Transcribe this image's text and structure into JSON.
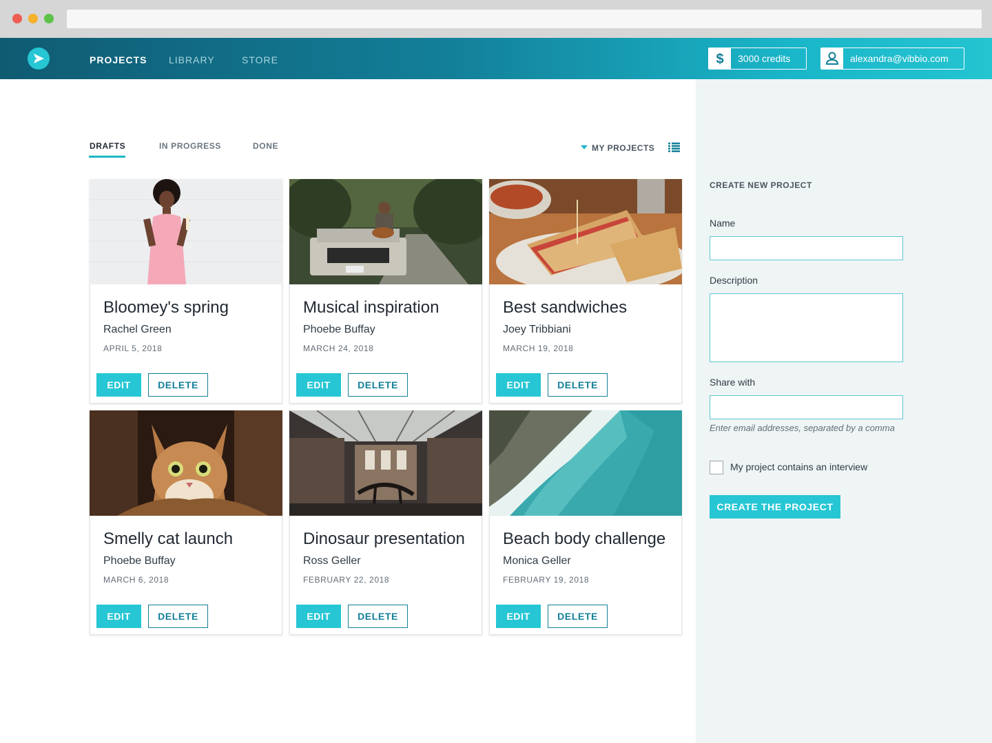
{
  "header": {
    "nav": [
      "PROJECTS",
      "LIBRARY",
      "STORE"
    ],
    "credits": "3000 credits",
    "user_email": "alexandra@vibbio.com"
  },
  "tabs": [
    "DRAFTS",
    "IN PROGRESS",
    "DONE"
  ],
  "filter_label": "MY PROJECTS",
  "cards": [
    {
      "title": "Bloomey's spring",
      "author": "Rachel Green",
      "date": "APRIL 5, 2018"
    },
    {
      "title": "Musical inspiration",
      "author": "Phoebe Buffay",
      "date": "MARCH 24, 2018"
    },
    {
      "title": "Best sandwiches",
      "author": "Joey Tribbiani",
      "date": "MARCH 19, 2018"
    },
    {
      "title": "Smelly cat launch",
      "author": "Phoebe Buffay",
      "date": "MARCH 6, 2018"
    },
    {
      "title": "Dinosaur presentation",
      "author": "Ross Geller",
      "date": "FEBRUARY 22, 2018"
    },
    {
      "title": "Beach body challenge",
      "author": "Monica Geller",
      "date": "FEBRUARY 19, 2018"
    }
  ],
  "card_actions": {
    "edit": "EDIT",
    "delete": "DELETE"
  },
  "side": {
    "heading": "CREATE NEW PROJECT",
    "name_label": "Name",
    "description_label": "Description",
    "share_label": "Share with",
    "share_hint": "Enter email addresses, separated by a comma",
    "interview_label": "My project contains an interview",
    "create_button": "CREATE THE PROJECT"
  },
  "colors": {
    "accent": "#26c6d4",
    "header_dark": "#0f5b72",
    "panel_bg": "#eff5f5"
  },
  "icons": {
    "logo": "play-logo-icon",
    "credits": "dollar-icon",
    "user": "user-icon",
    "list": "list-view-icon"
  }
}
